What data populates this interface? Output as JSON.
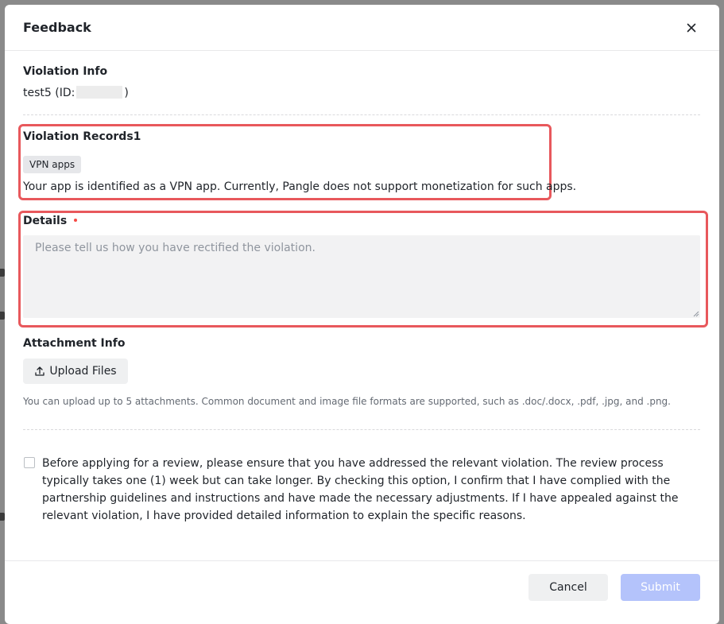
{
  "dialog": {
    "title": "Feedback",
    "close_icon": "close-icon"
  },
  "violation_info": {
    "heading": "Violation Info",
    "app_name": "test5",
    "id_prefix": "(ID:",
    "id_suffix": ")"
  },
  "violation_records": {
    "heading": "Violation Records1",
    "tag": "VPN apps",
    "description": "Your app is identified as a VPN app. Currently, Pangle does not support monetization for such apps."
  },
  "details": {
    "label": "Details",
    "placeholder": "Please tell us how you have rectified the violation.",
    "value": ""
  },
  "attachment": {
    "heading": "Attachment Info",
    "upload_icon": "upload-icon",
    "upload_label": "Upload Files",
    "hint": "You can upload up to 5 attachments. Common document and image file formats are supported, such as .doc/.docx, .pdf, .jpg, and .png."
  },
  "agreement": {
    "checked": false,
    "text": "Before applying for a review, please ensure that you have addressed the relevant violation. The review process typically takes one (1) week but can take longer. By checking this option, I confirm that I have complied with the partnership guidelines and instructions and have made the necessary adjustments. If I have appealed against the relevant violation, I have provided detailed information to explain the specific reasons."
  },
  "footer": {
    "cancel_label": "Cancel",
    "submit_label": "Submit"
  },
  "colors": {
    "highlight": "#e8585c",
    "submit_disabled": "#b4c3fb",
    "required": "#f54a45"
  }
}
